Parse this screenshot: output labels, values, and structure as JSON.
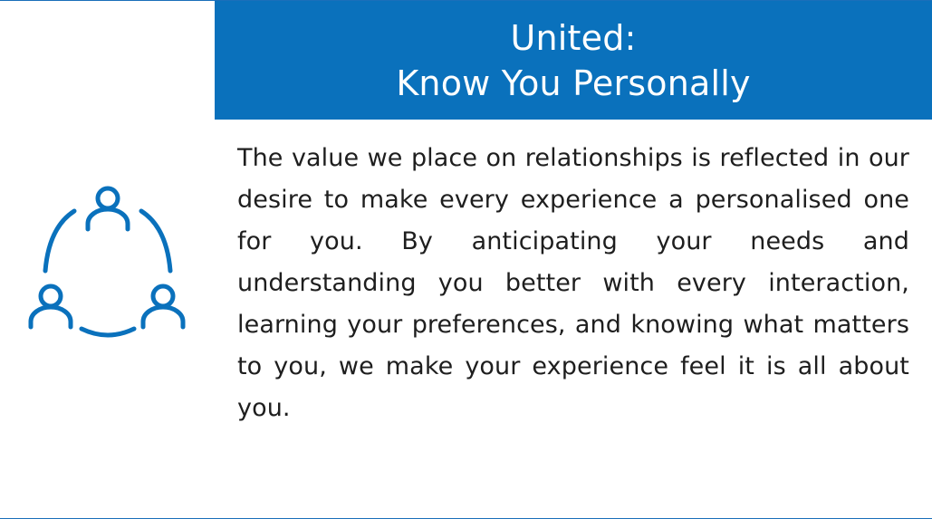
{
  "header": {
    "title_line1": "United:",
    "title_line2": "Know You Personally"
  },
  "body": {
    "paragraph": "The value we place on relationships is reflected in our desire to make every experience a personalised one for you. By anticipating your needs and understanding you better with every interaction, learning your preferences, and knowing what matters to you, we make your experience feel it is all about you."
  },
  "icon": {
    "name": "people-circle-icon"
  },
  "colors": {
    "accent": "#0a71bc",
    "text": "#1e1e1e",
    "background": "#ffffff"
  }
}
